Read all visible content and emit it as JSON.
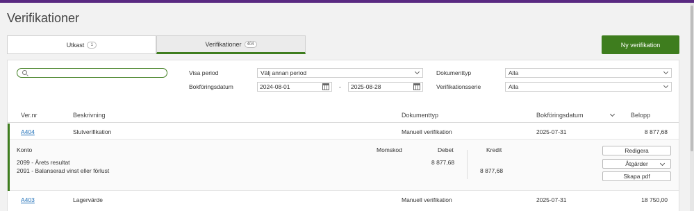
{
  "page": {
    "title": "Verifikationer"
  },
  "tabs": [
    {
      "label": "Utkast",
      "count": "1",
      "active": false
    },
    {
      "label": "Verifikationer",
      "count": "404",
      "active": true
    }
  ],
  "new_button": "Ny verifikation",
  "filters": {
    "search_value": "",
    "period_label": "Visa period",
    "period_value": "Välj annan period",
    "date_label": "Bokföringsdatum",
    "date_from": "2024-08-01",
    "date_separator": "-",
    "date_to": "2025-08-28",
    "doctype_label": "Dokumenttyp",
    "doctype_value": "Alla",
    "series_label": "Verifikationsserie",
    "series_value": "Alla"
  },
  "table": {
    "columns": {
      "vernr": "Ver.nr",
      "desc": "Beskrivning",
      "doctype": "Dokumenttyp",
      "date": "Bokföringsdatum",
      "amount": "Belopp"
    },
    "rows": [
      {
        "vernr": "A404",
        "desc": "Slutverifikation",
        "doctype": "Manuell verifikation",
        "date": "2025-07-31",
        "amount": "8 877,68",
        "expanded": true
      },
      {
        "vernr": "A403",
        "desc": "Lagervärde",
        "doctype": "Manuell verifikation",
        "date": "2025-07-31",
        "amount": "18 750,00",
        "expanded": false
      }
    ]
  },
  "detail": {
    "columns": {
      "account": "Konto",
      "vat": "Momskod",
      "debit": "Debet",
      "credit": "Kredit"
    },
    "lines": [
      {
        "account": "2099 - Årets resultat",
        "debit": "8 877,68",
        "credit": ""
      },
      {
        "account": "2091 - Balanserad vinst eller förlust",
        "debit": "",
        "credit": "8 877,68"
      }
    ],
    "actions": {
      "edit": "Redigera",
      "actions": "Åtgärder",
      "pdf": "Skapa pdf"
    }
  }
}
